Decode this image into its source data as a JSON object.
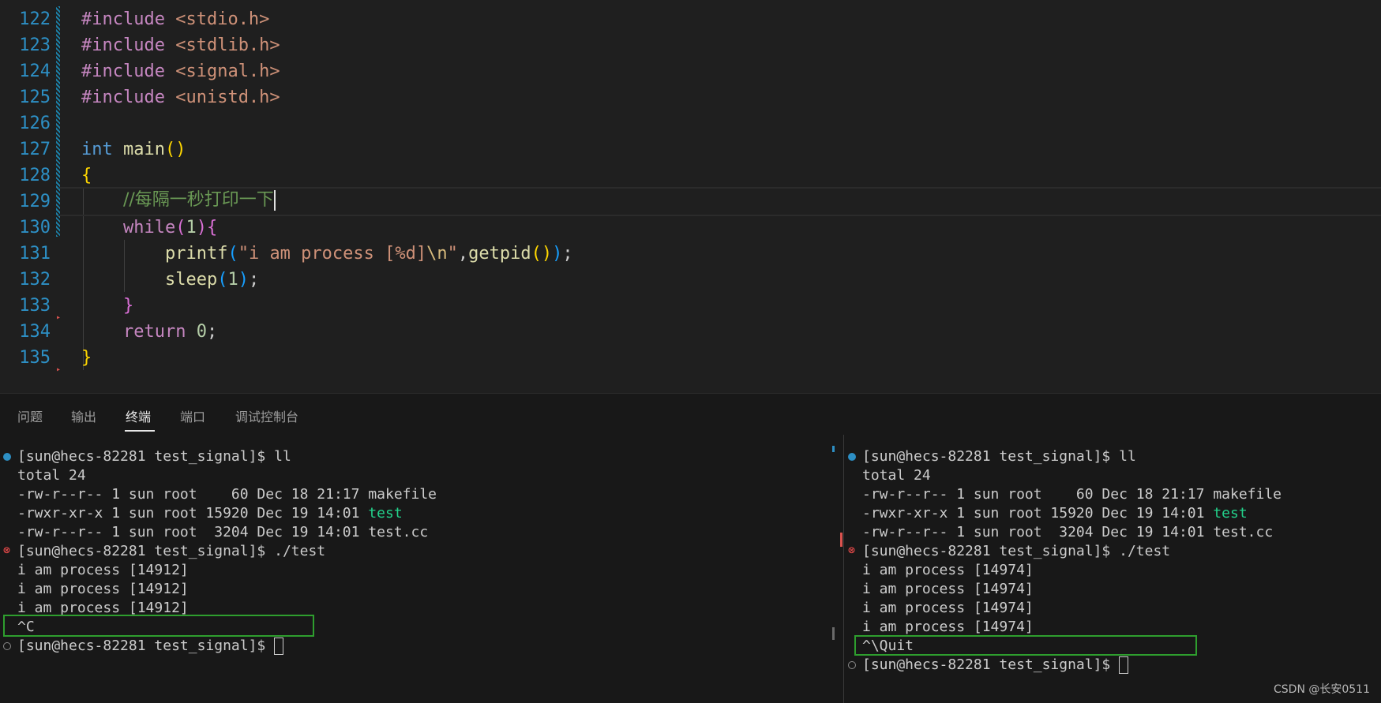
{
  "editor": {
    "line_numbers": [
      "122",
      "123",
      "124",
      "125",
      "126",
      "127",
      "128",
      "129",
      "130",
      "131",
      "132",
      "133",
      "134",
      "135"
    ],
    "include_kw": "#include",
    "headers": [
      "<stdio.h>",
      "<stdlib.h>",
      "<signal.h>",
      "<unistd.h>"
    ],
    "type_int": "int",
    "main_name": "main",
    "paren_pair": "()",
    "brace_open": "{",
    "brace_close": "}",
    "comment": "//每隔一秒打印一下",
    "kw_while": "while",
    "paren_open": "(",
    "paren_close": ")",
    "num_one": "1",
    "fn_printf": "printf",
    "string_open": "\"i am process [%d]",
    "string_escape": "\\n",
    "string_close": "\"",
    "comma": ",",
    "fn_getpid": "getpid",
    "semicolon": ";",
    "fn_sleep": "sleep",
    "kw_return": "return",
    "num_zero": "0"
  },
  "panel": {
    "tabs": [
      "问题",
      "输出",
      "终端",
      "端口",
      "调试控制台"
    ],
    "active_tab": "终端"
  },
  "terminal_left": {
    "lines": [
      "[sun@hecs-82281 test_signal]$ ll",
      "total 24",
      "-rw-r--r-- 1 sun root    60 Dec 18 21:17 makefile",
      "-rwxr-xr-x 1 sun root 15920 Dec 19 14:01 ",
      "-rw-r--r-- 1 sun root  3204 Dec 19 14:01 test.cc",
      "[sun@hecs-82281 test_signal]$ ./test",
      "i am process [14912]",
      "i am process [14912]",
      "i am process [14912]",
      "^C",
      "[sun@hecs-82281 test_signal]$ "
    ],
    "exec_name": "test"
  },
  "terminal_right": {
    "lines": [
      "[sun@hecs-82281 test_signal]$ ll",
      "total 24",
      "-rw-r--r-- 1 sun root    60 Dec 18 21:17 makefile",
      "-rwxr-xr-x 1 sun root 15920 Dec 19 14:01 ",
      "-rw-r--r-- 1 sun root  3204 Dec 19 14:01 test.cc",
      "[sun@hecs-82281 test_signal]$ ./test",
      "i am process [14974]",
      "i am process [14974]",
      "i am process [14974]",
      "i am process [14974]",
      "^\\Quit",
      "[sun@hecs-82281 test_signal]$ "
    ],
    "exec_name": "test"
  },
  "colors": {
    "accent_blue": "#2d8fc4",
    "error_red": "#f14c4c",
    "highlight_green": "#2e9e2e",
    "executable_green": "#23d18b"
  },
  "watermark": "CSDN @长安0511"
}
